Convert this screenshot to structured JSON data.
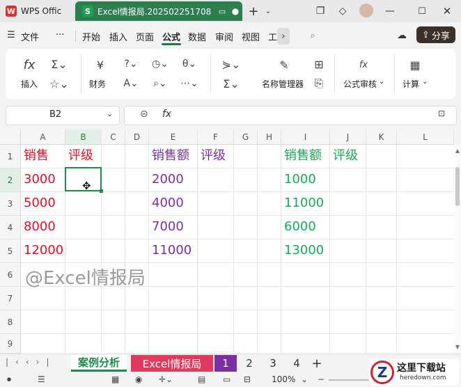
{
  "titlebar": {
    "app_tab": "WPS Offic",
    "doc_tab": "Excel情报局.202502251708",
    "add_icon": "plus-icon",
    "brand_color": "#2d7f4f"
  },
  "menubar": {
    "file": "文件",
    "more": "···",
    "items": [
      "开始",
      "插入",
      "页面",
      "公式",
      "数据",
      "审阅",
      "视图",
      "工"
    ],
    "active": "公式",
    "share": "分享"
  },
  "ribbon": {
    "insert_fn": "插入",
    "finance": "财务",
    "name_manager": "名称管理器",
    "formula_audit": "公式审核",
    "calculate": "计算"
  },
  "formula_bar": {
    "name_box": "B2",
    "fx": "fx",
    "content": ""
  },
  "grid": {
    "columns": [
      "A",
      "B",
      "C",
      "D",
      "E",
      "F",
      "G",
      "H",
      "I",
      "J",
      "K",
      "L"
    ],
    "rows": [
      "1",
      "2",
      "3",
      "4",
      "5",
      "6",
      "7",
      "8",
      "9"
    ],
    "selected_cell": "B2",
    "A": [
      "销售",
      "3000",
      "5000",
      "8000",
      "12000"
    ],
    "B1": "评级",
    "E": [
      "销售额",
      "2000",
      "4000",
      "7000",
      "11000"
    ],
    "F1": "评级",
    "I": [
      "销售额",
      "1000",
      "11000",
      "6000",
      "13000"
    ],
    "J1": "评级",
    "watermark": "@Excel情报局",
    "colors": {
      "red": "#e0102a",
      "purple": "#7b2fa0",
      "green": "#18a95a"
    }
  },
  "sheets": {
    "tabs": [
      "案例分析",
      "Excel情报局",
      "1",
      "2",
      "3",
      "4"
    ],
    "add": "+"
  },
  "statusbar": {
    "zoom": "100%"
  },
  "site_logo": {
    "name": "这里下载站",
    "url_text": "heredown.com"
  }
}
